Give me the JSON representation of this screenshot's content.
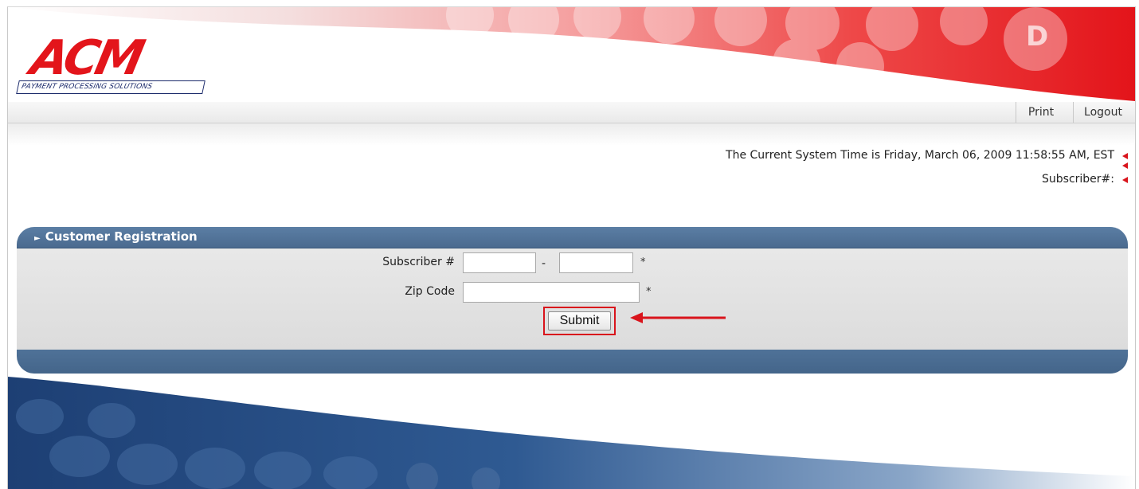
{
  "brand": {
    "logo_text": "ACM",
    "tagline": "PAYMENT PROCESSING SOLUTIONS",
    "logo_color": "#e3151b",
    "tagline_color": "#1b2a6b"
  },
  "toolbar": {
    "print_label": "Print",
    "logout_label": "Logout"
  },
  "system": {
    "time_text": "The Current System Time is Friday, March 06, 2009 11:58:55 AM, EST",
    "subscriber_text": "Subscriber#:",
    "indicator_color": "#d9141c"
  },
  "panel": {
    "title": "Customer Registration",
    "header_color": "#4a6a8f"
  },
  "form": {
    "subscriber_label": "Subscriber #",
    "subscriber_part1_value": "",
    "subscriber_part2_value": "",
    "separator": "-",
    "required_marker": "*",
    "zip_label": "Zip Code",
    "zip_value": "",
    "submit_label": "Submit"
  },
  "annotation": {
    "highlight_color": "#d9141c"
  }
}
